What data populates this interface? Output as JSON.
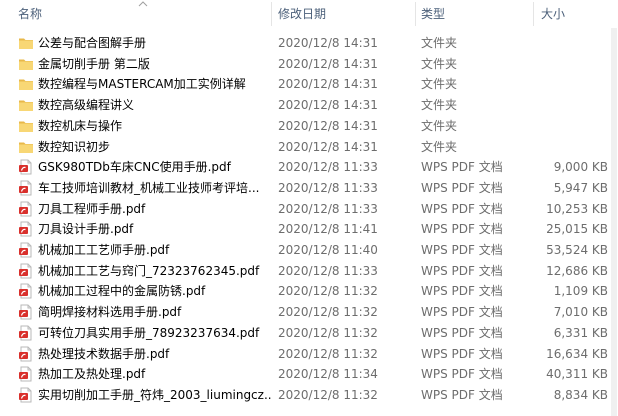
{
  "columns": {
    "name": "名称",
    "date": "修改日期",
    "type": "类型",
    "size": "大小"
  },
  "sort": {
    "column": "name",
    "direction": "ascending",
    "icon": "sort-up-arrow-icon"
  },
  "colors": {
    "folder": "#f8d775",
    "folder_dark": "#e8b84a",
    "pdf_red": "#d9302c",
    "header_text": "#4c607a"
  },
  "files": [
    {
      "name": "公差与配合图解手册",
      "date": "2020/12/8 14:31",
      "type": "文件夹",
      "size": "",
      "icon": "folder-icon"
    },
    {
      "name": "金属切削手册 第二版",
      "date": "2020/12/8 14:31",
      "type": "文件夹",
      "size": "",
      "icon": "folder-icon"
    },
    {
      "name": "数控编程与MASTERCAM加工实例详解",
      "date": "2020/12/8 14:31",
      "type": "文件夹",
      "size": "",
      "icon": "folder-icon"
    },
    {
      "name": "数控高级编程讲义",
      "date": "2020/12/8 14:31",
      "type": "文件夹",
      "size": "",
      "icon": "folder-icon"
    },
    {
      "name": "数控机床与操作",
      "date": "2020/12/8 14:31",
      "type": "文件夹",
      "size": "",
      "icon": "folder-icon"
    },
    {
      "name": "数控知识初步",
      "date": "2020/12/8 14:31",
      "type": "文件夹",
      "size": "",
      "icon": "folder-icon"
    },
    {
      "name": "GSK980TDb车床CNC使用手册.pdf",
      "date": "2020/12/8 11:33",
      "type": "WPS PDF 文档",
      "size": "9,000 KB",
      "icon": "pdf-icon"
    },
    {
      "name": "车工技师培训教材_机械工业技师考评培...",
      "date": "2020/12/8 11:33",
      "type": "WPS PDF 文档",
      "size": "5,947 KB",
      "icon": "pdf-icon"
    },
    {
      "name": "刀具工程师手册.pdf",
      "date": "2020/12/8 11:33",
      "type": "WPS PDF 文档",
      "size": "10,253 KB",
      "icon": "pdf-icon"
    },
    {
      "name": "刀具设计手册.pdf",
      "date": "2020/12/8 11:41",
      "type": "WPS PDF 文档",
      "size": "25,015 KB",
      "icon": "pdf-icon"
    },
    {
      "name": "机械加工工艺师手册.pdf",
      "date": "2020/12/8 11:40",
      "type": "WPS PDF 文档",
      "size": "53,524 KB",
      "icon": "pdf-icon"
    },
    {
      "name": "机械加工工艺与窍门_72323762345.pdf",
      "date": "2020/12/8 11:33",
      "type": "WPS PDF 文档",
      "size": "12,686 KB",
      "icon": "pdf-icon"
    },
    {
      "name": "机械加工过程中的金属防锈.pdf",
      "date": "2020/12/8 11:32",
      "type": "WPS PDF 文档",
      "size": "1,109 KB",
      "icon": "pdf-icon"
    },
    {
      "name": "简明焊接材料选用手册.pdf",
      "date": "2020/12/8 11:32",
      "type": "WPS PDF 文档",
      "size": "7,010 KB",
      "icon": "pdf-icon"
    },
    {
      "name": "可转位刀具实用手册_78923237634.pdf",
      "date": "2020/12/8 11:32",
      "type": "WPS PDF 文档",
      "size": "6,331 KB",
      "icon": "pdf-icon"
    },
    {
      "name": "热处理技术数据手册.pdf",
      "date": "2020/12/8 11:32",
      "type": "WPS PDF 文档",
      "size": "16,634 KB",
      "icon": "pdf-icon"
    },
    {
      "name": "热加工及热处理.pdf",
      "date": "2020/12/8 11:34",
      "type": "WPS PDF 文档",
      "size": "40,311 KB",
      "icon": "pdf-icon"
    },
    {
      "name": "实用切削加工手册_符炜_2003_liumingcz...",
      "date": "2020/12/8 11:32",
      "type": "WPS PDF 文档",
      "size": "8,834 KB",
      "icon": "pdf-icon"
    }
  ]
}
